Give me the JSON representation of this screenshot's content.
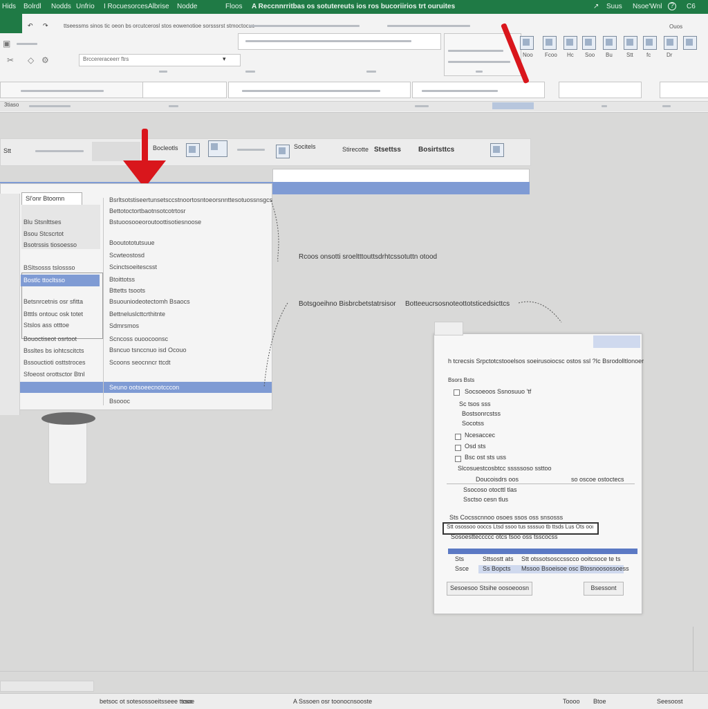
{
  "title_bar": {
    "tabs": [
      "Hids",
      "Bolrdl",
      "Nodds",
      "Unfrio",
      "I Rocuesorces",
      "Albrise",
      "Nodde",
      "Floos"
    ],
    "document_title": "A Reccnnrritbas os sotutereuts ios ros bucoriirios trt ouruites",
    "right_items": [
      "Suus",
      "Nsoe'Wnl",
      "?",
      "C6"
    ]
  },
  "ribbon": {
    "row1_text": "ttseessms  sinos tic oeon bs orcutcerosl stos eowenotioe sorsssrst stmoctocuc",
    "name_box": "3tiaso",
    "formula_box": "Brccereraceerr ftrs",
    "right_label": "Ouos",
    "buttons": [
      "Noo",
      "Fcoo",
      "Hc",
      "Soo",
      "Bu",
      "Stt",
      "fc",
      "Dr"
    ]
  },
  "inner_panel": {
    "header_items": [
      "Stt",
      "Bocleotls",
      "Socitels",
      "Stirecotte",
      "Bosirtsttcs"
    ],
    "title": "Stsettss"
  },
  "left_list": {
    "header": "Sl'onr Btoomn",
    "col1": [
      "Blu Stsnlttses",
      "Bsou Stcscrtot",
      "Bsotrssis tiosoesso",
      "BSltsosss tslossso",
      "Bostlc ttocltsso",
      "Betsnrcetnis osr sfitta",
      "Btttls ontouc osk totet",
      "Stslos ass otttoe",
      "Bouoctiseot osrtoot",
      "Bssltes bs iohtcscitcts",
      "Bssouctioti osttstroces",
      "Sfoeost orottsctor Btnl"
    ],
    "col2": [
      "Bsrltsotstiseertunsetsccstnoortosntoeorsnnttesotuossnsgcs",
      "Bettotoctortbaotnsotcotrtosr",
      "Bstuoosooeoroutoottisotiesnoose",
      "Booutototutsuue",
      "Scwteostosd",
      "Scinctsoeitescsst",
      "Btoittotss",
      "Bttetts tsoots",
      "Bsuouniodeotectomh Bsaocs",
      "Bettneluslcttcrthitnte",
      "Sdmrsmos",
      "Scncoss ouoocoonsc",
      "Bsncuo tsnccnuo isd Ocouo",
      "Scoons seocnncr ttcdt",
      "Seuno ootsoeecnotcccon",
      "Bsoooc"
    ]
  },
  "callouts": {
    "c1": "Rcoos onsotti sroeltttouttsdrhtcssotuttn otood",
    "c2": "Botsgoeihno Bisbrcbetstatrsisor",
    "c3": "Botteeucrsosnoteottotsticedsicttcs"
  },
  "dialog": {
    "title": "h tcrecsis  Srpctotcstooelsos soeirusoiocsc ostos ssl  ?Ic  Bsrodolltlonoer",
    "section": "Bsors Bsts",
    "options": [
      "Socsoeoos Ssnosuuo 'tf",
      "Sc tsos sss",
      "Bostsonrcstss",
      "Socotss",
      "Ncesaccec",
      "Osd sts",
      "Bsc ost sts uss",
      "Slcosuestcosbtcc sssssoso ssttoo"
    ],
    "col_left": "Doucoisdrs oos",
    "col_right": "so oscoe ostoctecs",
    "row_a": "Ssocoso otocttl tlas",
    "row_b": "Ssctso cesn tlus",
    "list_header": "Sts Cocsscnnoo osoes ssos oss snsosss",
    "highlighted": "Stt osossoo ooccs Ltsd ssoo tus ssssuo tb ttsds Lus Ots oou ttoo",
    "list_item": "Sosoestteccccc otcs tsoo oss tsscocss",
    "grid_header": [
      "Sts",
      "Sttsostt ats",
      "Stt otssotsosccsscco ooitcsoce te ts"
    ],
    "grid_row": [
      "Ssce",
      "Ss Bopcts",
      "Mssoo Bsoeisoe osc  Btosnoosossoess"
    ],
    "ok_button": "Sesoesoo  Stsihe oosoeoosn",
    "cancel_button": "Bsessont"
  },
  "status_bar": {
    "sheet_tab": "betsoc ot sotesossoeitsseee tssoe",
    "mode": "tcso",
    "center_text": "A Sssoen osr toonocnsooste",
    "right_items": [
      "Toooo",
      "Btoe",
      "Seesoost"
    ]
  }
}
